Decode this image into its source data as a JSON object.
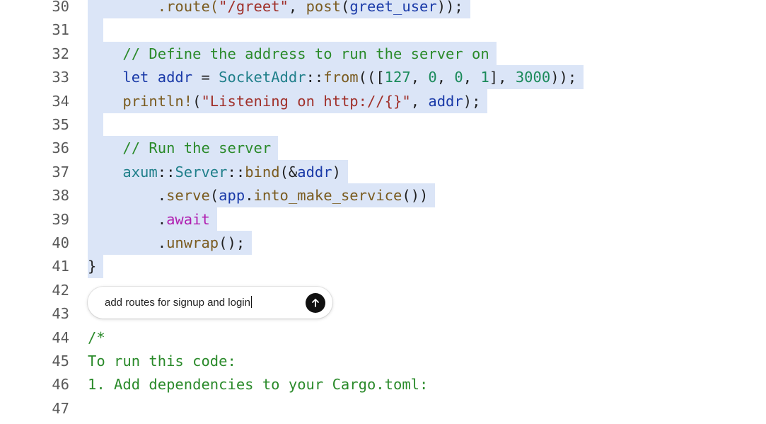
{
  "editor": {
    "lines": [
      {
        "num": "30",
        "tokens": [
          [
            "t-default",
            "        "
          ],
          [
            "t-fn",
            ".route("
          ],
          [
            "t-str",
            "\"/greet\""
          ],
          [
            "t-default",
            ", "
          ],
          [
            "t-fn",
            "post"
          ],
          [
            "t-default",
            "("
          ],
          [
            "t-var",
            "greet_user"
          ],
          [
            "t-default",
            "));"
          ]
        ],
        "selected": true
      },
      {
        "num": "31",
        "tokens": [
          [
            "t-default",
            " "
          ]
        ],
        "selected": true
      },
      {
        "num": "32",
        "tokens": [
          [
            "t-default",
            "    "
          ],
          [
            "t-comment",
            "// Define the address to run the server on"
          ]
        ],
        "selected": true
      },
      {
        "num": "33",
        "tokens": [
          [
            "t-default",
            "    "
          ],
          [
            "t-kw",
            "let "
          ],
          [
            "t-var",
            "addr"
          ],
          [
            "t-default",
            " = "
          ],
          [
            "t-type",
            "SocketAddr"
          ],
          [
            "t-default",
            "::"
          ],
          [
            "t-fn",
            "from"
          ],
          [
            "t-default",
            "((["
          ],
          [
            "t-num",
            "127"
          ],
          [
            "t-default",
            ", "
          ],
          [
            "t-num",
            "0"
          ],
          [
            "t-default",
            ", "
          ],
          [
            "t-num",
            "0"
          ],
          [
            "t-default",
            ", "
          ],
          [
            "t-num",
            "1"
          ],
          [
            "t-default",
            "], "
          ],
          [
            "t-num",
            "3000"
          ],
          [
            "t-default",
            "));"
          ]
        ],
        "selected": true
      },
      {
        "num": "34",
        "tokens": [
          [
            "t-default",
            "    "
          ],
          [
            "t-macro",
            "println!"
          ],
          [
            "t-default",
            "("
          ],
          [
            "t-str",
            "\"Listening on http://{}\""
          ],
          [
            "t-default",
            ", "
          ],
          [
            "t-var",
            "addr"
          ],
          [
            "t-default",
            ");"
          ]
        ],
        "selected": true
      },
      {
        "num": "35",
        "tokens": [
          [
            "t-default",
            " "
          ]
        ],
        "selected": true
      },
      {
        "num": "36",
        "tokens": [
          [
            "t-default",
            "    "
          ],
          [
            "t-comment",
            "// Run the server"
          ]
        ],
        "selected": true
      },
      {
        "num": "37",
        "tokens": [
          [
            "t-default",
            "    "
          ],
          [
            "t-type",
            "axum"
          ],
          [
            "t-default",
            "::"
          ],
          [
            "t-type",
            "Server"
          ],
          [
            "t-default",
            "::"
          ],
          [
            "t-fn",
            "bind"
          ],
          [
            "t-default",
            "(&"
          ],
          [
            "t-var",
            "addr"
          ],
          [
            "t-default",
            ")"
          ]
        ],
        "selected": true
      },
      {
        "num": "38",
        "tokens": [
          [
            "t-default",
            "        ."
          ],
          [
            "t-fn",
            "serve"
          ],
          [
            "t-default",
            "("
          ],
          [
            "t-var",
            "app"
          ],
          [
            "t-default",
            "."
          ],
          [
            "t-fn",
            "into_make_service"
          ],
          [
            "t-default",
            "())"
          ]
        ],
        "selected": true
      },
      {
        "num": "39",
        "tokens": [
          [
            "t-default",
            "        ."
          ],
          [
            "t-await",
            "await"
          ]
        ],
        "selected": true
      },
      {
        "num": "40",
        "tokens": [
          [
            "t-default",
            "        ."
          ],
          [
            "t-fn",
            "unwrap"
          ],
          [
            "t-default",
            "();"
          ]
        ],
        "selected": true
      },
      {
        "num": "41",
        "tokens": [
          [
            "t-default",
            "}"
          ]
        ],
        "selected": true
      },
      {
        "num": "42",
        "tokens": [],
        "selected": false
      },
      {
        "num": "43",
        "tokens": [],
        "selected": false
      },
      {
        "num": "44",
        "tokens": [
          [
            "t-comment",
            "/*"
          ]
        ],
        "selected": false
      },
      {
        "num": "45",
        "tokens": [
          [
            "t-comment",
            "To run this code:"
          ]
        ],
        "selected": false
      },
      {
        "num": "46",
        "tokens": [
          [
            "t-comment",
            "1. Add dependencies to your Cargo.toml:"
          ]
        ],
        "selected": false
      },
      {
        "num": "47",
        "tokens": [],
        "selected": false
      }
    ]
  },
  "prompt": {
    "value": "add routes for signup and login",
    "send_icon": "arrow-up-icon"
  }
}
